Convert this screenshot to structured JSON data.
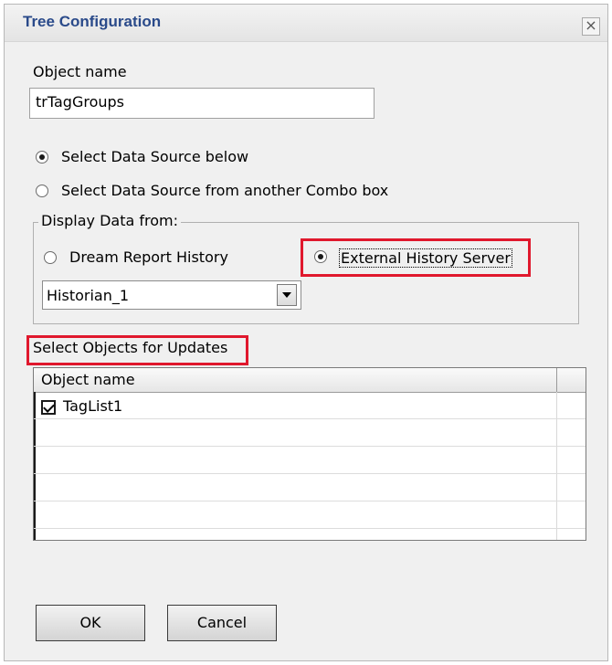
{
  "window": {
    "title": "Tree Configuration",
    "close_glyph": "×"
  },
  "object_name": {
    "label": "Object name",
    "value": "trTagGroups"
  },
  "data_source": {
    "options": [
      {
        "label": "Select Data Source below",
        "selected": true
      },
      {
        "label": "Select Data Source from another Combo box",
        "selected": false
      }
    ]
  },
  "display_data": {
    "legend": "Display Data from:",
    "options": [
      {
        "label": "Dream Report History",
        "selected": false
      },
      {
        "label": "External History Server",
        "selected": true
      }
    ],
    "combo_value": "Historian_1"
  },
  "objects_section": {
    "title": "Select Objects for Updates",
    "column_header": "Object name",
    "rows": [
      {
        "label": "TagList1",
        "checked": true
      }
    ]
  },
  "buttons": {
    "ok": "OK",
    "cancel": "Cancel"
  },
  "colors": {
    "title_text": "#2a4a8a",
    "highlight": "#e0182d",
    "dialog_bg": "#f0f0f0"
  }
}
